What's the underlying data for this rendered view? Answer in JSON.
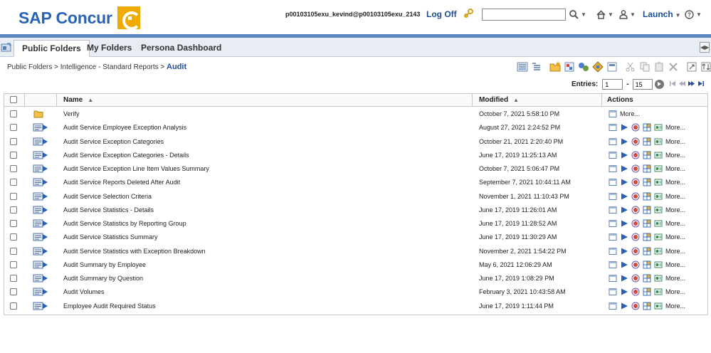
{
  "header": {
    "logo_text": "SAP Concur",
    "logo_mark": "C",
    "user": "p00103105exu_kevind@p00103105exu_2143",
    "logoff_label": "Log Off",
    "search_value": "",
    "launch_label": "Launch",
    "icons": [
      "link-icon",
      "search-icon",
      "home-icon",
      "user-icon",
      "help-icon"
    ]
  },
  "tabs": [
    {
      "label": "Public Folders",
      "active": true
    },
    {
      "label": "My Folders",
      "active": false
    },
    {
      "label": "Persona Dashboard",
      "active": false
    }
  ],
  "breadcrumb": {
    "parts": [
      "Public Folders",
      "Intelligence - Standard Reports"
    ],
    "separator": ">",
    "current": "Audit"
  },
  "paging": {
    "entries_label": "Entries:",
    "from": "1",
    "dash": "-",
    "to": "15"
  },
  "table": {
    "columns": {
      "name": "Name",
      "modified": "Modified",
      "actions": "Actions"
    },
    "more_label": "More...",
    "rows": [
      {
        "type": "folder",
        "name": "Verify",
        "modified": "October 7, 2021 5:58:10 PM"
      },
      {
        "type": "report",
        "name": "Audit Service Employee Exception Analysis",
        "modified": "August 27, 2021 2:24:52 PM"
      },
      {
        "type": "report",
        "name": "Audit Service Exception Categories",
        "modified": "October 21, 2021 2:20:40 PM"
      },
      {
        "type": "report",
        "name": "Audit Service Exception Categories - Details",
        "modified": "June 17, 2019 11:25:13 AM"
      },
      {
        "type": "report",
        "name": "Audit Service Exception Line Item Values Summary",
        "modified": "October 7, 2021 5:06:47 PM"
      },
      {
        "type": "report",
        "name": "Audit Service Reports Deleted After Audit",
        "modified": "September 7, 2021 10:44:11 AM"
      },
      {
        "type": "report",
        "name": "Audit Service Selection Criteria",
        "modified": "November 1, 2021 11:10:43 PM"
      },
      {
        "type": "report",
        "name": "Audit Service Statistics - Details",
        "modified": "June 17, 2019 11:26:01 AM"
      },
      {
        "type": "report",
        "name": "Audit Service Statistics by Reporting Group",
        "modified": "June 17, 2019 11:28:52 AM"
      },
      {
        "type": "report",
        "name": "Audit Service Statistics Summary",
        "modified": "June 17, 2019 11:30:29 AM"
      },
      {
        "type": "report",
        "name": "Audit Service Statistics with Exception Breakdown",
        "modified": "November 2, 2021 1:54:22 PM"
      },
      {
        "type": "report",
        "name": "Audit Summary by Employee",
        "modified": "May 6, 2021 12:06:29 AM"
      },
      {
        "type": "report",
        "name": "Audit Summary by Question",
        "modified": "June 17, 2019 1:08:29 PM"
      },
      {
        "type": "report",
        "name": "Audit Volumes",
        "modified": "February 3, 2021 10:43:58 AM"
      },
      {
        "type": "report",
        "name": "Employee Audit Required Status",
        "modified": "June 17, 2019 1:11:44 PM"
      }
    ]
  },
  "colors": {
    "brand_blue": "#2a62b8",
    "brand_gold": "#f0ab00",
    "link_blue": "#1d4e97",
    "accent_bar": "#5b88c0"
  }
}
